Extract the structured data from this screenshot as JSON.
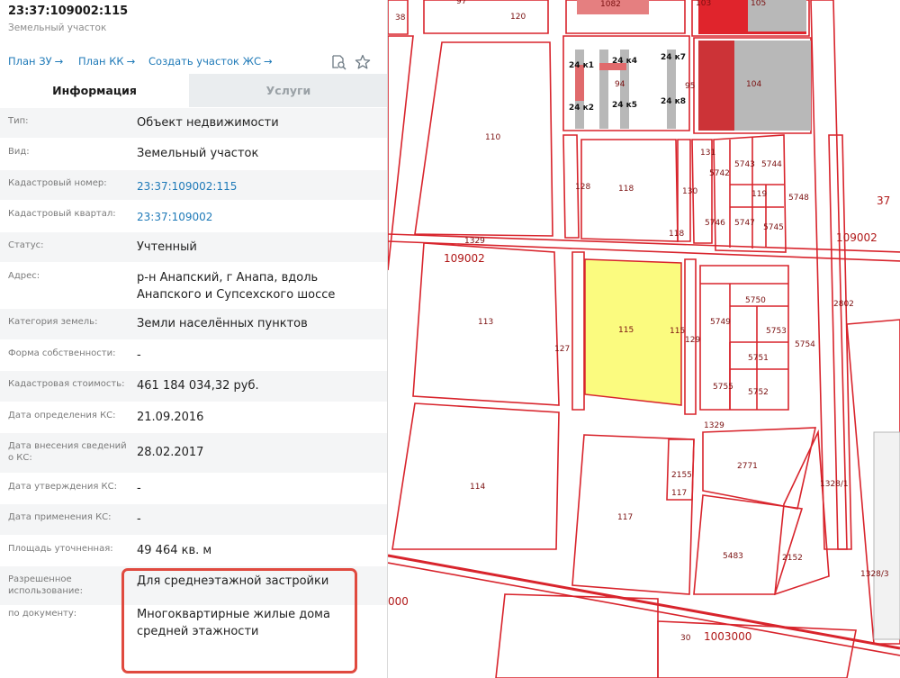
{
  "header": {
    "title": "23:37:109002:115",
    "subtitle": "Земельный участок"
  },
  "links": [
    {
      "label": "План ЗУ",
      "arrow": "→"
    },
    {
      "label": "План КК",
      "arrow": "→"
    },
    {
      "label": "Создать участок ЖС",
      "arrow": "→"
    }
  ],
  "icons": {
    "search": "search-document-icon",
    "favorite": "star-icon"
  },
  "tabs": [
    {
      "label": "Информация",
      "active": true
    },
    {
      "label": "Услуги",
      "active": false
    }
  ],
  "properties": [
    {
      "label": "Тип:",
      "value": "Объект недвижимости"
    },
    {
      "label": "Вид:",
      "value": "Земельный участок"
    },
    {
      "label": "Кадастровый номер:",
      "value": "23:37:109002:115",
      "link": true
    },
    {
      "label": "Кадастровый квартал:",
      "value": "23:37:109002",
      "link": true
    },
    {
      "label": "Статус:",
      "value": "Учтенный"
    },
    {
      "label": "Адрес:",
      "value": "р-н Анапский, г Анапа, вдоль Анапского и Супсехского шоссе"
    },
    {
      "label": "Категория земель:",
      "value": "Земли населённых пунктов"
    },
    {
      "label": "Форма собственности:",
      "value": "-"
    },
    {
      "label": "Кадастровая стоимость:",
      "value": "461 184 034,32 руб."
    },
    {
      "label": "Дата определения КС:",
      "value": "21.09.2016"
    },
    {
      "label": "Дата внесения сведений о КС:",
      "value": "28.02.2017"
    },
    {
      "label": "Дата утверждения КС:",
      "value": "-"
    },
    {
      "label": "Дата применения КС:",
      "value": "-"
    },
    {
      "label": "Площадь уточненная:",
      "value": "49 464 кв. м"
    },
    {
      "label": "Разрешенное использование:",
      "value": "Для среднеэтажной застройки"
    },
    {
      "label": "по документу:",
      "value": "Многоквартирные жилые дома средней этажности"
    }
  ],
  "colors": {
    "accent_link": "#1f7ab8",
    "highlight_border": "#e04a3f",
    "parcel_line": "#d8242c",
    "selected_parcel": "#fbfb7f",
    "building_fill": "#b8b8b8",
    "building_red": "#e0242c"
  },
  "map": {
    "labels": [
      "38",
      "120",
      "97",
      "1082",
      "103",
      "105",
      "24 к1",
      "24 к4",
      "24 к7",
      "94",
      "95",
      "24 к2",
      "24 к5",
      "24 к8",
      "104",
      "110",
      "128",
      "118",
      "130",
      "131",
      "5742",
      "5743",
      "5744",
      "119",
      "5748",
      "5747",
      "5745",
      "5746",
      "118",
      "37",
      "109002",
      "1329",
      "109002",
      "113",
      "127",
      "115",
      "115",
      "129",
      "5750",
      "5749",
      "5753",
      "5754",
      "5751",
      "5755",
      "5752",
      "2802",
      "1329",
      "114",
      "2155",
      "117",
      "117",
      "2771",
      "1328/1",
      "5483",
      "2152",
      "1328/3",
      "000",
      "30",
      "1003000"
    ]
  }
}
